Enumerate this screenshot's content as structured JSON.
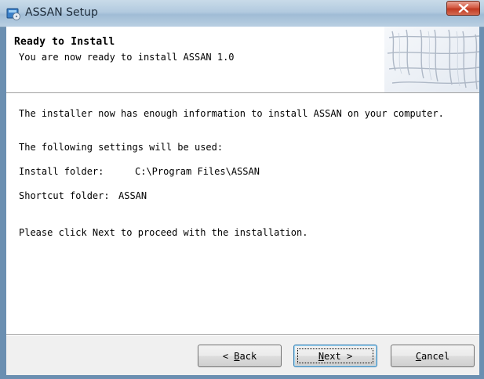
{
  "window": {
    "title": "ASSAN Setup"
  },
  "header": {
    "title": "Ready to Install",
    "subtitle": "You are now ready to install ASSAN 1.0"
  },
  "body": {
    "intro": "The installer now has enough information to install ASSAN on your computer.",
    "settings_heading": "The following settings will be used:",
    "install_folder_label": "Install folder:",
    "install_folder_value": "C:\\Program Files\\ASSAN",
    "shortcut_folder_label": "Shortcut folder:",
    "shortcut_folder_value": "ASSAN",
    "proceed_text": "Please click Next to proceed with the installation."
  },
  "buttons": {
    "back": {
      "prefix": "< ",
      "accel": "B",
      "rest": "ack"
    },
    "next": {
      "prefix": "",
      "accel": "N",
      "rest": "ext >"
    },
    "cancel": {
      "prefix": "",
      "accel": "C",
      "rest": "ancel"
    }
  },
  "icons": {
    "app": "setup-disc-icon",
    "close": "close-icon",
    "banner": "wizard-banner-image"
  },
  "colors": {
    "close_button": "#c94a30",
    "title_bar": "#b2cadf"
  }
}
